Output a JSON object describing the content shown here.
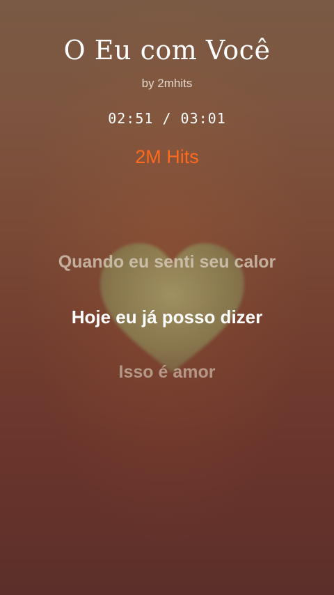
{
  "song": {
    "title": "O Eu com Você",
    "artist": "by 2mhits",
    "time_display": "02:51 / 03:01",
    "brand": "2M Hits"
  },
  "lyrics": {
    "previous": "Quando eu senti seu calor",
    "current": "Hoje eu já posso dizer",
    "next": "Isso é amor"
  },
  "colors": {
    "background_top": "#7a5a44",
    "background_bottom": "#5c2f2a",
    "brand": "#ff6a1f",
    "heart": "#9aa06a",
    "current_lyric": "#ffffff"
  },
  "icons": {
    "heart": "heart-icon"
  }
}
